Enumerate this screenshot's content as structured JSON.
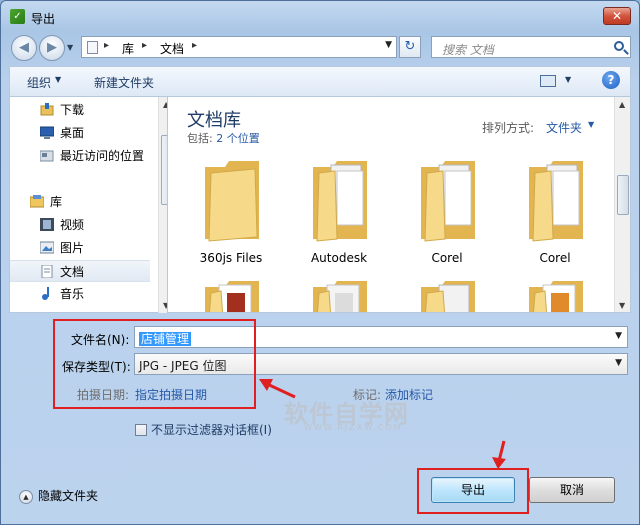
{
  "window": {
    "title": "导出",
    "close_glyph": "✕",
    "app_icon_glyph": "✓"
  },
  "address": {
    "parts": [
      "库",
      "文档"
    ],
    "separator": "▸"
  },
  "search": {
    "placeholder": "搜索 文档"
  },
  "toolbar": {
    "organize": "组织",
    "new_folder": "新建文件夹",
    "help_glyph": "?"
  },
  "sidebar": {
    "items": [
      {
        "label": "下载",
        "icon": "download-icon"
      },
      {
        "label": "桌面",
        "icon": "desktop-icon"
      },
      {
        "label": "最近访问的位置",
        "icon": "recent-places-icon"
      },
      {
        "label": "库",
        "icon": "library-icon"
      },
      {
        "label": "视频",
        "icon": "video-icon"
      },
      {
        "label": "图片",
        "icon": "pictures-icon"
      },
      {
        "label": "文档",
        "icon": "documents-icon",
        "selected": true
      },
      {
        "label": "音乐",
        "icon": "music-icon"
      }
    ]
  },
  "library": {
    "title": "文档库",
    "includes_label": "包括:",
    "includes_link": "2 个位置",
    "arrange_label": "排列方式:",
    "arrange_value": "文件夹"
  },
  "folders": [
    {
      "name": "360js Files"
    },
    {
      "name": "Autodesk"
    },
    {
      "name": "Corel"
    },
    {
      "name": "Corel"
    }
  ],
  "form": {
    "filename_label": "文件名(N):",
    "filename_value": "店铺管理",
    "filetype_label": "保存类型(T):",
    "filetype_value": "JPG - JPEG 位图",
    "date_label": "拍摄日期:",
    "date_link": "指定拍摄日期",
    "tags_label": "标记:",
    "tags_link": "添加标记",
    "no_filter_label": "不显示过滤器对话框(I)"
  },
  "footer": {
    "hide_folders": "隐藏文件夹",
    "export_button": "导出",
    "cancel_button": "取消"
  },
  "watermark": {
    "main": "软件自学网",
    "sub": "WWW.RJZXW.COM"
  },
  "colors": {
    "annotation_red": "#e02020",
    "link_blue": "#2659a8",
    "folder_yellow": "#f3d27a"
  }
}
